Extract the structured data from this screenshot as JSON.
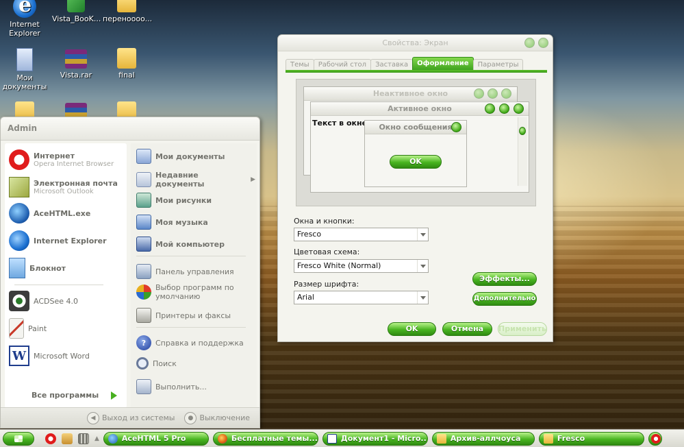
{
  "desktop": {
    "icons": [
      {
        "label": "Internet Explorer"
      },
      {
        "label": "Vista_BooK..."
      },
      {
        "label": "перенoooo..."
      },
      {
        "label": "Мои документы"
      },
      {
        "label": "Vista.rar"
      },
      {
        "label": "final"
      }
    ]
  },
  "start_menu": {
    "user": "Admin",
    "pinned": [
      {
        "name": "Интернет",
        "sub": "Opera Internet Browser"
      },
      {
        "name": "Электронная почта",
        "sub": "Microsoft Outlook"
      }
    ],
    "recent": [
      {
        "name": "AceHTML.exe"
      },
      {
        "name": "Internet Explorer"
      },
      {
        "name": "Блокнот"
      },
      {
        "name": "ACDSee 4.0"
      },
      {
        "name": "Paint"
      },
      {
        "name": "Microsoft Word"
      }
    ],
    "all_programs": "Все программы",
    "right_bold": [
      {
        "name": "Мои документы"
      },
      {
        "name": "Недавние документы"
      },
      {
        "name": "Мои рисунки"
      },
      {
        "name": "Моя музыка"
      },
      {
        "name": "Мой компьютер"
      }
    ],
    "right_normal": [
      {
        "name": "Панель управления"
      },
      {
        "name": "Выбор программ по умолчанию"
      },
      {
        "name": "Принтеры и факсы"
      },
      {
        "name": "Справка и поддержка"
      },
      {
        "name": "Поиск"
      },
      {
        "name": "Выполнить..."
      }
    ],
    "logoff": "Выход из системы",
    "shutdown": "Выключение"
  },
  "dialog": {
    "title": "Свойства: Экран",
    "tabs": [
      "Темы",
      "Рабочий стол",
      "Заставка",
      "Оформление",
      "Параметры"
    ],
    "active_tab": "Оформление",
    "preview": {
      "inactive_title": "Неактивное окно",
      "active_title": "Активное окно",
      "window_text": "Текст в окне",
      "message_title": "Окно сообщения",
      "ok": "OK"
    },
    "fields": {
      "windows_label": "Окна и кнопки:",
      "windows_value": "Fresco",
      "scheme_label": "Цветовая схема:",
      "scheme_value": "Fresco White (Normal)",
      "font_label": "Размер шрифта:",
      "font_value": "Arial"
    },
    "effects_button": "Эффекты...",
    "advanced_button": "Дополнительно",
    "ok_button": "OK",
    "cancel_button": "Отмена",
    "apply_button": "Применить"
  },
  "taskbar": {
    "buttons": [
      {
        "label": "AceHTML 5 Pro"
      },
      {
        "label": "Бесплатные темы..."
      },
      {
        "label": "Документ1 - Micro..."
      },
      {
        "label": "Архив-аллчоуса"
      },
      {
        "label": "Fresco"
      }
    ]
  },
  "colors": {
    "accent_green": "#48b420",
    "accent_dark": "#2a7a10"
  }
}
